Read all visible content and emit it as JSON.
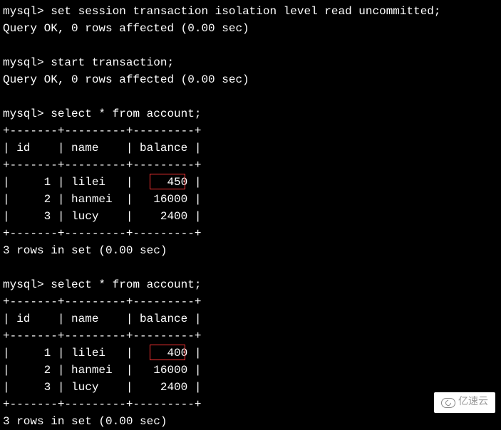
{
  "prompt": "mysql>",
  "commands": {
    "set_isolation": "set session transaction isolation level read uncommitted;",
    "start_tx": "start transaction;",
    "select1": "select * from account;",
    "select2": "select * from account;"
  },
  "responses": {
    "query_ok": "Query OK, 0 rows affected (0.00 sec)",
    "rows_in_set": "3 rows in set (0.00 sec)"
  },
  "table": {
    "border_top": "+-------+---------+---------+",
    "header_row": "| id    | name    | balance |",
    "columns": [
      "id",
      "name",
      "balance"
    ]
  },
  "result1": {
    "rows": [
      {
        "id": 1,
        "name": "lilei",
        "balance": 450,
        "highlight": true
      },
      {
        "id": 2,
        "name": "hanmei",
        "balance": 16000
      },
      {
        "id": 3,
        "name": "lucy",
        "balance": 2400
      }
    ],
    "lines": [
      "|     1 | lilei   |     450 |",
      "|     2 | hanmei  |   16000 |",
      "|     3 | lucy    |    2400 |"
    ]
  },
  "result2": {
    "rows": [
      {
        "id": 1,
        "name": "lilei",
        "balance": 400,
        "highlight": true
      },
      {
        "id": 2,
        "name": "hanmei",
        "balance": 16000
      },
      {
        "id": 3,
        "name": "lucy",
        "balance": 2400
      }
    ],
    "lines": [
      "|     1 | lilei   |     400 |",
      "|     2 | hanmei  |   16000 |",
      "|     3 | lucy    |    2400 |"
    ]
  },
  "watermark": {
    "text": "亿速云"
  }
}
